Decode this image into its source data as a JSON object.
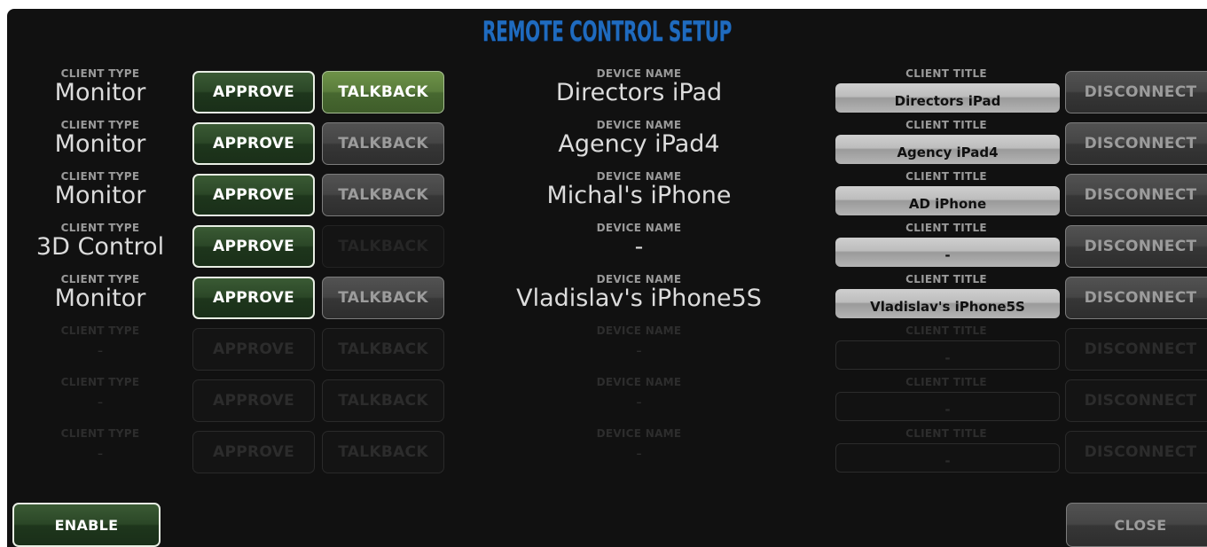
{
  "title": "REMOTE CONTROL SETUP",
  "labels": {
    "client_type": "CLIENT TYPE",
    "device_name": "DEVICE NAME",
    "client_title": "CLIENT TITLE",
    "approve": "APPROVE",
    "talkback": "TALKBACK",
    "disconnect": "DISCONNECT"
  },
  "rows": [
    {
      "client_type": "Monitor",
      "device_name": "Directors iPad",
      "client_title": "Directors iPad",
      "talkback_state": "active"
    },
    {
      "client_type": "Monitor",
      "device_name": "Agency iPad4",
      "client_title": "Agency iPad4",
      "talkback_state": "enabled"
    },
    {
      "client_type": "Monitor",
      "device_name": "Michal's iPhone",
      "client_title": "AD iPhone",
      "talkback_state": "enabled"
    },
    {
      "client_type": "3D Control",
      "device_name": "-",
      "client_title": "-",
      "talkback_state": "disabled"
    },
    {
      "client_type": "Monitor",
      "device_name": "Vladislav's iPhone5S",
      "client_title": "Vladislav's iPhone5S",
      "talkback_state": "enabled"
    },
    {
      "client_type": "-",
      "device_name": "-",
      "client_title": "-",
      "talkback_state": "empty"
    },
    {
      "client_type": "-",
      "device_name": "-",
      "client_title": "-",
      "talkback_state": "empty"
    },
    {
      "client_type": "-",
      "device_name": "-",
      "client_title": "-",
      "talkback_state": "empty"
    }
  ],
  "footer": {
    "enable_label": "ENABLE",
    "close_label": "CLOSE"
  },
  "colors": {
    "title": "#1f6bbf",
    "background": "#111111",
    "approve_green": "#2b4727",
    "talkback_active": "#5a7d3c"
  }
}
